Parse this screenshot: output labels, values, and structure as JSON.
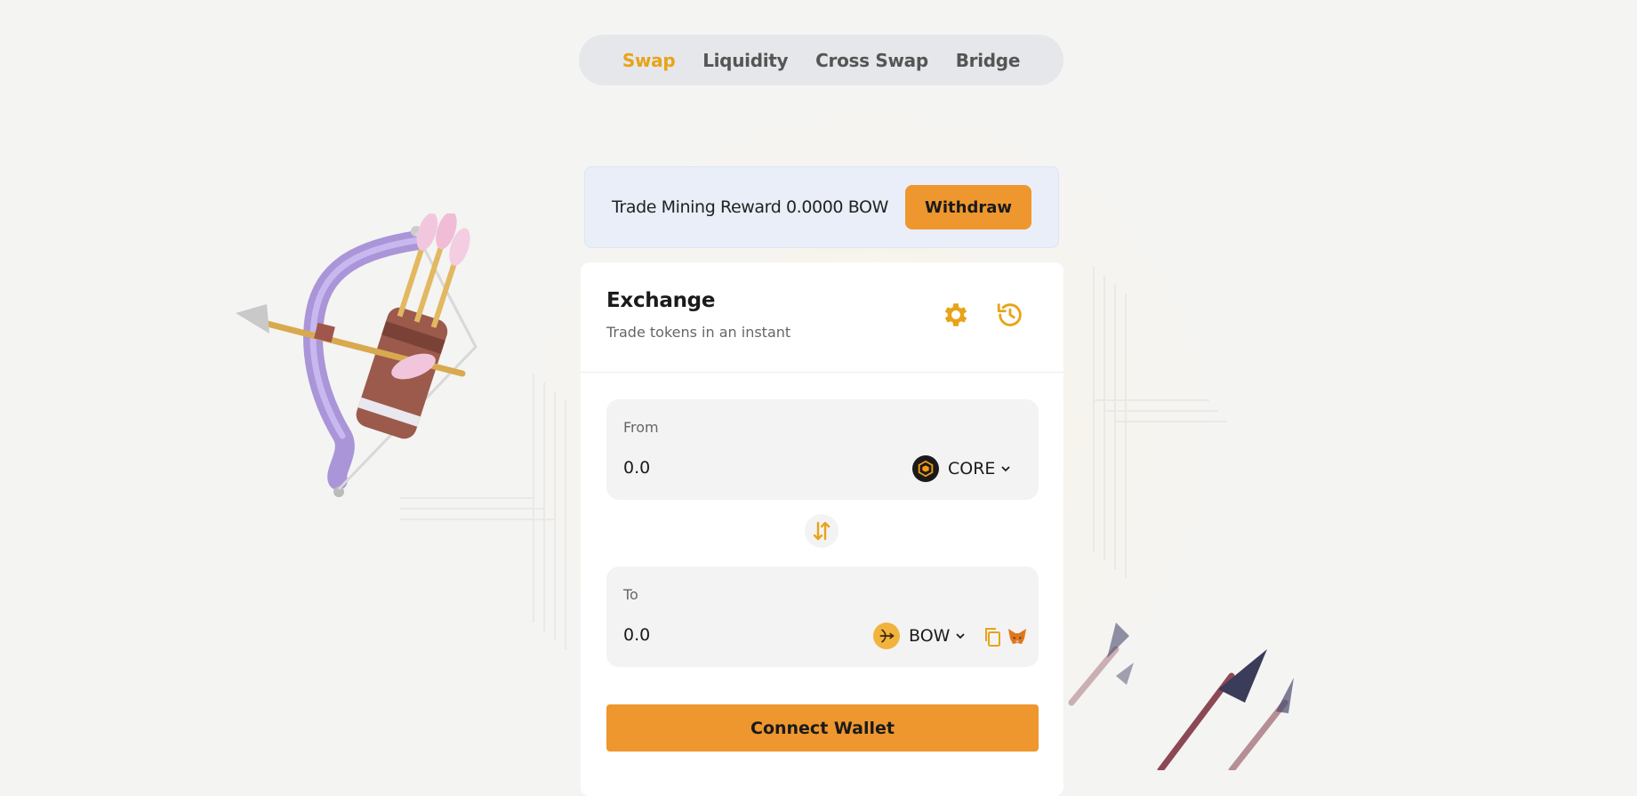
{
  "nav": {
    "tabs": [
      {
        "label": "Swap",
        "active": true
      },
      {
        "label": "Liquidity",
        "active": false
      },
      {
        "label": "Cross Swap",
        "active": false
      },
      {
        "label": "Bridge",
        "active": false
      }
    ]
  },
  "reward": {
    "text": "Trade Mining Reward 0.0000 BOW",
    "withdraw_label": "Withdraw"
  },
  "exchange": {
    "title": "Exchange",
    "subtitle": "Trade tokens in an instant",
    "from": {
      "label": "From",
      "amount_placeholder": "0.0",
      "token": "CORE",
      "token_icon": "core-logo-icon"
    },
    "to": {
      "label": "To",
      "amount_placeholder": "0.0",
      "token": "BOW",
      "token_icon": "bow-logo-icon"
    },
    "connect_label": "Connect Wallet"
  },
  "colors": {
    "accent": "#e8a317",
    "button": "#ee972f",
    "nav_bg": "#e6e7ea",
    "banner_bg": "#e9eef8"
  },
  "icons": [
    "gear-icon",
    "history-icon",
    "swap-arrows-icon",
    "chevron-down-icon",
    "copy-icon",
    "metamask-fox-icon"
  ]
}
